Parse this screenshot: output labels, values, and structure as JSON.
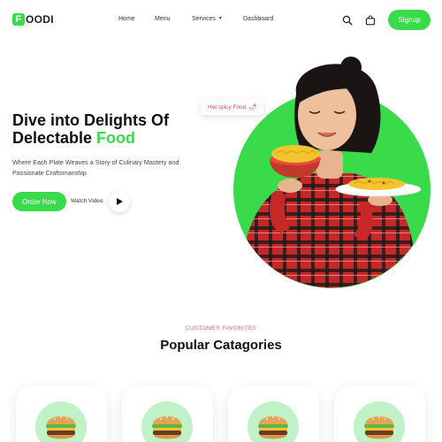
{
  "brand": {
    "badge": "F",
    "rest": "OODI"
  },
  "nav": {
    "links": [
      "Home",
      "Menu",
      "Services",
      "Dashboard"
    ],
    "signup_label": "Signup"
  },
  "hero": {
    "title_line1": "Dive into Delights Of",
    "title_line2_prefix": "Delectable ",
    "title_line2_highlight": "Food",
    "subtitle": "Where Each Plate Weaves a Story of Culinary Mastery and Passionate Craftsmanship",
    "order_label": "Order Now",
    "watch_label": "Watch Video",
    "tag_label": "Hot spicy Food"
  },
  "categories": {
    "kicker": "CUSTOMER FAVORITES",
    "title": "Popular Catagories"
  },
  "colors": {
    "accent": "#39DB4A",
    "red": "#FF6868",
    "mint": "#C1F1C6"
  }
}
